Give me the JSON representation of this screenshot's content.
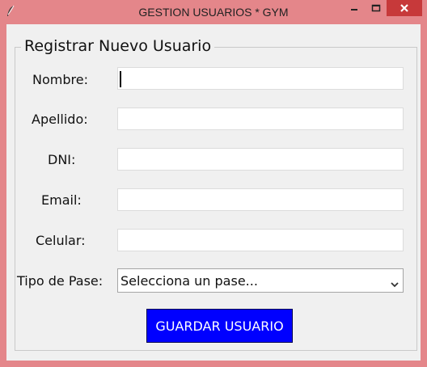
{
  "window": {
    "title": "GESTION USUARIOS * GYM",
    "controls": [
      "minimize-icon",
      "maximize-icon",
      "close-icon"
    ],
    "colors": {
      "frame": "#e4868a",
      "close": "#c7393a"
    }
  },
  "form": {
    "legend": "Registrar Nuevo Usuario",
    "fields": {
      "nombre": {
        "label": "Nombre:",
        "value": ""
      },
      "apellido": {
        "label": "Apellido:",
        "value": ""
      },
      "dni": {
        "label": "DNI:",
        "value": ""
      },
      "email": {
        "label": "Email:",
        "value": ""
      },
      "celular": {
        "label": "Celular:",
        "value": ""
      }
    },
    "pass_type": {
      "label": "Tipo de Pase:",
      "selected": "Selecciona un pase..."
    },
    "save_label": "GUARDAR USUARIO",
    "colors": {
      "button_bg": "#0000ff",
      "button_text": "#ffffff"
    }
  }
}
